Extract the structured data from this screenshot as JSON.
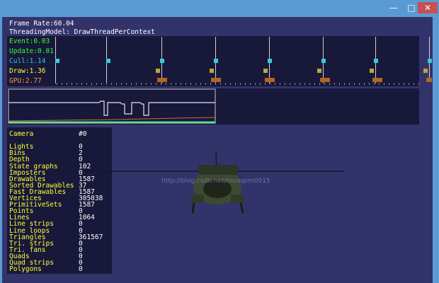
{
  "window": {
    "buttons": {
      "minimize": "—",
      "maximize": "□",
      "close": "✕"
    }
  },
  "hud": {
    "frame_rate": "Frame Rate:60.04",
    "threading_model": "ThreadingModel: DrawThreadPerContext"
  },
  "timing": {
    "event": {
      "label": "Event:0.03",
      "color": "#33ff33"
    },
    "update": {
      "label": "Update:0.01",
      "color": "#33ff33"
    },
    "cull": {
      "label": "Cull:1.14",
      "color": "#33ccdd"
    },
    "draw": {
      "label": "Draw:1.36",
      "color": "#ffff33"
    },
    "gpu": {
      "label": "GPU:2.77",
      "color": "#ff9933"
    }
  },
  "stats": [
    {
      "key": "Camera",
      "value": "#0"
    },
    {
      "key": "",
      "value": ""
    },
    {
      "key": "Lights",
      "value": "0"
    },
    {
      "key": "Bins",
      "value": "2"
    },
    {
      "key": "Depth",
      "value": "0"
    },
    {
      "key": "State graphs",
      "value": "102"
    },
    {
      "key": "Imposters",
      "value": "0"
    },
    {
      "key": "Drawables",
      "value": "1587"
    },
    {
      "key": "Sorted Drawables",
      "value": "37"
    },
    {
      "key": "Fast Drawables",
      "value": "1587"
    },
    {
      "key": "Vertices",
      "value": "305038"
    },
    {
      "key": "PrimitiveSets",
      "value": "1587"
    },
    {
      "key": "Points",
      "value": "0"
    },
    {
      "key": "Lines",
      "value": "1064"
    },
    {
      "key": "Line strips",
      "value": "0"
    },
    {
      "key": "Line loops",
      "value": "0"
    },
    {
      "key": "Triangles",
      "value": "361567"
    },
    {
      "key": "Tri. strips",
      "value": "0"
    },
    {
      "key": "Tri. fans",
      "value": "0"
    },
    {
      "key": "Quads",
      "value": "0"
    },
    {
      "key": "Quad strips",
      "value": "0"
    },
    {
      "key": "Polygons",
      "value": "0"
    }
  ],
  "watermark": "http://blog.csdn.net/muaqsm0915",
  "colors": {
    "background": "#33336b",
    "titlebar": "#5b9bd5",
    "panel": "#18183a",
    "stat_key": "#ffff33"
  }
}
